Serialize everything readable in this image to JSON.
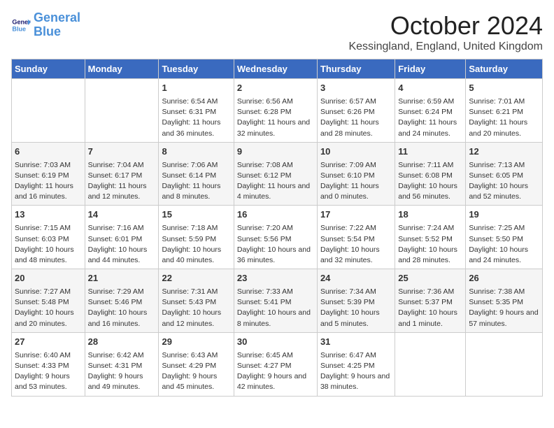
{
  "header": {
    "logo_line1": "General",
    "logo_line2": "Blue",
    "month_title": "October 2024",
    "location": "Kessingland, England, United Kingdom"
  },
  "days_of_week": [
    "Sunday",
    "Monday",
    "Tuesday",
    "Wednesday",
    "Thursday",
    "Friday",
    "Saturday"
  ],
  "weeks": [
    [
      {
        "day": "",
        "info": ""
      },
      {
        "day": "",
        "info": ""
      },
      {
        "day": "1",
        "info": "Sunrise: 6:54 AM\nSunset: 6:31 PM\nDaylight: 11 hours and 36 minutes."
      },
      {
        "day": "2",
        "info": "Sunrise: 6:56 AM\nSunset: 6:28 PM\nDaylight: 11 hours and 32 minutes."
      },
      {
        "day": "3",
        "info": "Sunrise: 6:57 AM\nSunset: 6:26 PM\nDaylight: 11 hours and 28 minutes."
      },
      {
        "day": "4",
        "info": "Sunrise: 6:59 AM\nSunset: 6:24 PM\nDaylight: 11 hours and 24 minutes."
      },
      {
        "day": "5",
        "info": "Sunrise: 7:01 AM\nSunset: 6:21 PM\nDaylight: 11 hours and 20 minutes."
      }
    ],
    [
      {
        "day": "6",
        "info": "Sunrise: 7:03 AM\nSunset: 6:19 PM\nDaylight: 11 hours and 16 minutes."
      },
      {
        "day": "7",
        "info": "Sunrise: 7:04 AM\nSunset: 6:17 PM\nDaylight: 11 hours and 12 minutes."
      },
      {
        "day": "8",
        "info": "Sunrise: 7:06 AM\nSunset: 6:14 PM\nDaylight: 11 hours and 8 minutes."
      },
      {
        "day": "9",
        "info": "Sunrise: 7:08 AM\nSunset: 6:12 PM\nDaylight: 11 hours and 4 minutes."
      },
      {
        "day": "10",
        "info": "Sunrise: 7:09 AM\nSunset: 6:10 PM\nDaylight: 11 hours and 0 minutes."
      },
      {
        "day": "11",
        "info": "Sunrise: 7:11 AM\nSunset: 6:08 PM\nDaylight: 10 hours and 56 minutes."
      },
      {
        "day": "12",
        "info": "Sunrise: 7:13 AM\nSunset: 6:05 PM\nDaylight: 10 hours and 52 minutes."
      }
    ],
    [
      {
        "day": "13",
        "info": "Sunrise: 7:15 AM\nSunset: 6:03 PM\nDaylight: 10 hours and 48 minutes."
      },
      {
        "day": "14",
        "info": "Sunrise: 7:16 AM\nSunset: 6:01 PM\nDaylight: 10 hours and 44 minutes."
      },
      {
        "day": "15",
        "info": "Sunrise: 7:18 AM\nSunset: 5:59 PM\nDaylight: 10 hours and 40 minutes."
      },
      {
        "day": "16",
        "info": "Sunrise: 7:20 AM\nSunset: 5:56 PM\nDaylight: 10 hours and 36 minutes."
      },
      {
        "day": "17",
        "info": "Sunrise: 7:22 AM\nSunset: 5:54 PM\nDaylight: 10 hours and 32 minutes."
      },
      {
        "day": "18",
        "info": "Sunrise: 7:24 AM\nSunset: 5:52 PM\nDaylight: 10 hours and 28 minutes."
      },
      {
        "day": "19",
        "info": "Sunrise: 7:25 AM\nSunset: 5:50 PM\nDaylight: 10 hours and 24 minutes."
      }
    ],
    [
      {
        "day": "20",
        "info": "Sunrise: 7:27 AM\nSunset: 5:48 PM\nDaylight: 10 hours and 20 minutes."
      },
      {
        "day": "21",
        "info": "Sunrise: 7:29 AM\nSunset: 5:46 PM\nDaylight: 10 hours and 16 minutes."
      },
      {
        "day": "22",
        "info": "Sunrise: 7:31 AM\nSunset: 5:43 PM\nDaylight: 10 hours and 12 minutes."
      },
      {
        "day": "23",
        "info": "Sunrise: 7:33 AM\nSunset: 5:41 PM\nDaylight: 10 hours and 8 minutes."
      },
      {
        "day": "24",
        "info": "Sunrise: 7:34 AM\nSunset: 5:39 PM\nDaylight: 10 hours and 5 minutes."
      },
      {
        "day": "25",
        "info": "Sunrise: 7:36 AM\nSunset: 5:37 PM\nDaylight: 10 hours and 1 minute."
      },
      {
        "day": "26",
        "info": "Sunrise: 7:38 AM\nSunset: 5:35 PM\nDaylight: 9 hours and 57 minutes."
      }
    ],
    [
      {
        "day": "27",
        "info": "Sunrise: 6:40 AM\nSunset: 4:33 PM\nDaylight: 9 hours and 53 minutes."
      },
      {
        "day": "28",
        "info": "Sunrise: 6:42 AM\nSunset: 4:31 PM\nDaylight: 9 hours and 49 minutes."
      },
      {
        "day": "29",
        "info": "Sunrise: 6:43 AM\nSunset: 4:29 PM\nDaylight: 9 hours and 45 minutes."
      },
      {
        "day": "30",
        "info": "Sunrise: 6:45 AM\nSunset: 4:27 PM\nDaylight: 9 hours and 42 minutes."
      },
      {
        "day": "31",
        "info": "Sunrise: 6:47 AM\nSunset: 4:25 PM\nDaylight: 9 hours and 38 minutes."
      },
      {
        "day": "",
        "info": ""
      },
      {
        "day": "",
        "info": ""
      }
    ]
  ]
}
